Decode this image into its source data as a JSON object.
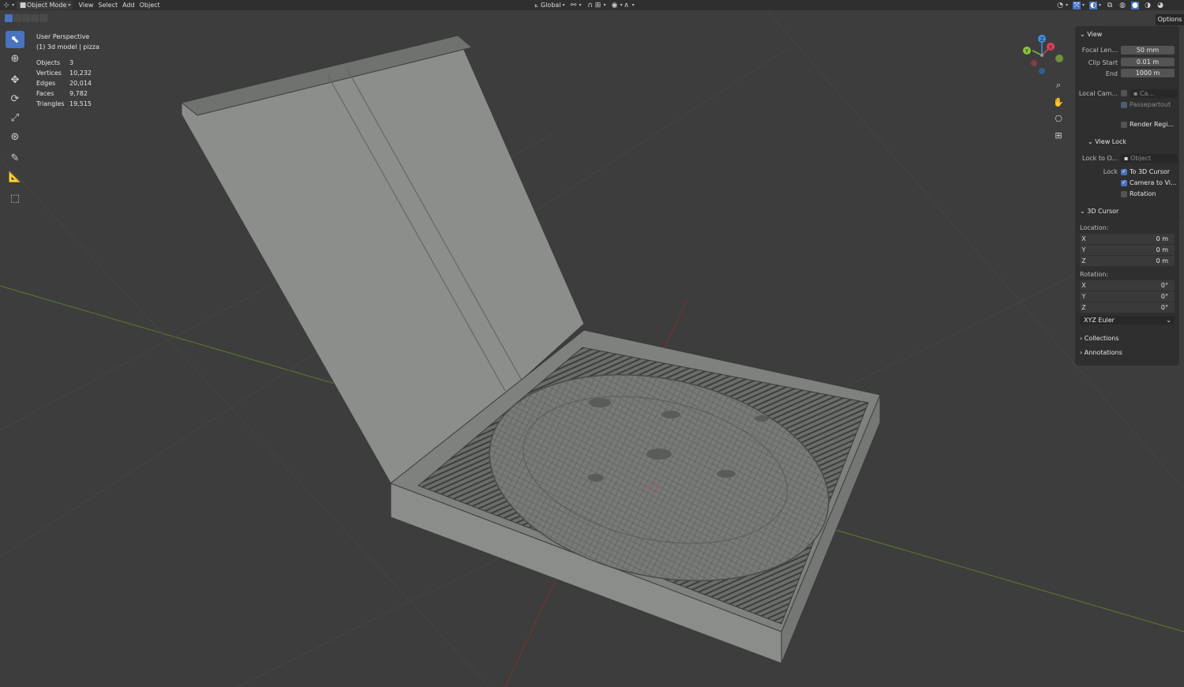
{
  "header": {
    "mode_label": "Object Mode",
    "menu": [
      "View",
      "Select",
      "Add",
      "Object"
    ],
    "transform_orientation": "Global"
  },
  "overlay": {
    "view_name": "User Perspective",
    "object_info": "(1) 3d model | pizza",
    "stats": [
      {
        "label": "Objects",
        "value": "3"
      },
      {
        "label": "Vertices",
        "value": "10,232"
      },
      {
        "label": "Edges",
        "value": "20,014"
      },
      {
        "label": "Faces",
        "value": "9,782"
      },
      {
        "label": "Triangles",
        "value": "19,515"
      }
    ]
  },
  "gizmo": {
    "x": "X",
    "y": "Y",
    "z": "Z"
  },
  "options_label": "Options",
  "sidebar": {
    "view": {
      "title": "View",
      "focal_length_label": "Focal Len...",
      "focal_length": "50 mm",
      "clip_start_label": "Clip Start",
      "clip_start": "0.01 m",
      "end_label": "End",
      "end": "1000 m",
      "local_camera_label": "Local Cam...",
      "local_camera_value": "Ca...",
      "passepartout_label": "Passepartout",
      "render_region_label": "Render Regi..."
    },
    "view_lock": {
      "title": "View Lock",
      "lock_to_object_label": "Lock to O...",
      "lock_to_object_placeholder": "Object",
      "lock_label": "Lock",
      "to_3d_cursor": "To 3D Cursor",
      "camera_to_view": "Camera to Vi...",
      "rotation": "Rotation"
    },
    "cursor": {
      "title": "3D Cursor",
      "location_label": "Location:",
      "location": [
        {
          "axis": "X",
          "value": "0 m"
        },
        {
          "axis": "Y",
          "value": "0 m"
        },
        {
          "axis": "Z",
          "value": "0 m"
        }
      ],
      "rotation_label": "Rotation:",
      "rotation": [
        {
          "axis": "X",
          "value": "0°"
        },
        {
          "axis": "Y",
          "value": "0°"
        },
        {
          "axis": "Z",
          "value": "0°"
        }
      ],
      "rotation_mode": "XYZ Euler"
    },
    "collections_title": "Collections",
    "annotations_title": "Annotations"
  },
  "colors": {
    "viewport_bg": "#3d3d3d",
    "accent": "#4773c0",
    "x_axis": "#e0415a",
    "y_axis": "#8dc63f",
    "z_axis": "#3e8ee8"
  }
}
